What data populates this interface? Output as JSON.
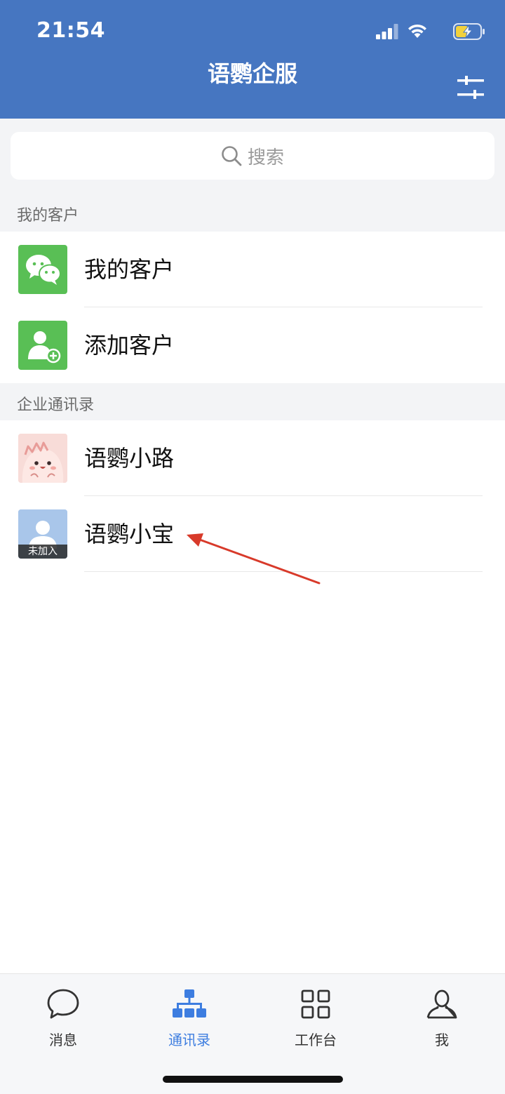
{
  "status_bar": {
    "time": "21:54"
  },
  "header": {
    "title": "语鹦企服"
  },
  "search": {
    "placeholder": "搜索"
  },
  "sections": {
    "customers": {
      "label": "我的客户",
      "items": [
        {
          "name": "我的客户",
          "icon": "wechat-icon"
        },
        {
          "name": "添加客户",
          "icon": "add-user-icon"
        }
      ]
    },
    "directory": {
      "label": "企业通讯录",
      "items": [
        {
          "name": "语鹦小路",
          "icon": "cartoon-avatar"
        },
        {
          "name": "语鹦小宝",
          "icon": "default-avatar",
          "badge": "未加入"
        }
      ]
    }
  },
  "tabs": [
    {
      "label": "消息",
      "icon": "chat-bubble-icon",
      "active": false
    },
    {
      "label": "通讯录",
      "icon": "org-chart-icon",
      "active": true
    },
    {
      "label": "工作台",
      "icon": "grid-icon",
      "active": false
    },
    {
      "label": "我",
      "icon": "person-icon",
      "active": false
    }
  ],
  "colors": {
    "header": "#4676c1",
    "accent": "#3d7de0",
    "green": "#59bf55",
    "annotation_arrow": "#d83a2a"
  }
}
